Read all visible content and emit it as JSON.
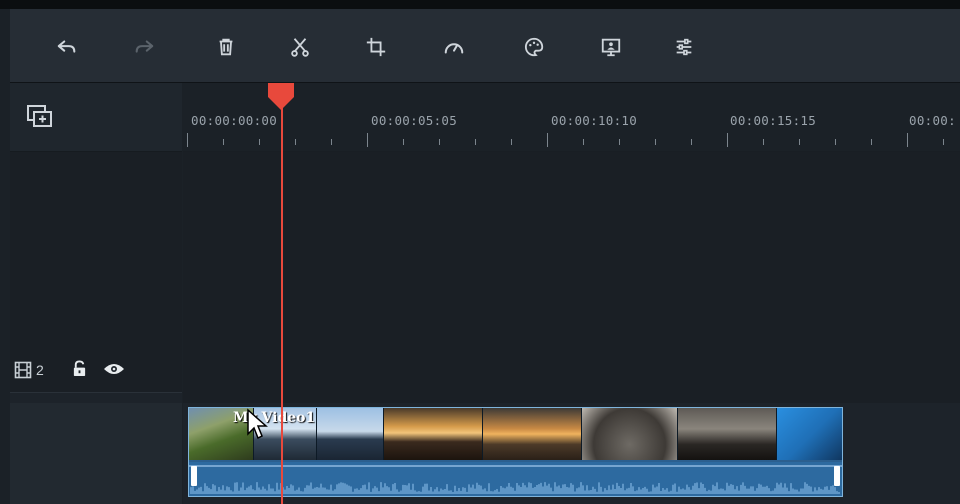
{
  "toolbar": {
    "tools": [
      {
        "name": "undo-icon",
        "label": "Undo",
        "enabled": true
      },
      {
        "name": "redo-icon",
        "label": "Redo",
        "enabled": false
      },
      {
        "name": "delete-icon",
        "label": "Delete",
        "enabled": true
      },
      {
        "name": "cut-icon",
        "label": "Split",
        "enabled": true
      },
      {
        "name": "crop-icon",
        "label": "Crop",
        "enabled": true
      },
      {
        "name": "speed-icon",
        "label": "Speed",
        "enabled": true
      },
      {
        "name": "color-icon",
        "label": "Color",
        "enabled": true
      },
      {
        "name": "green-screen-icon",
        "label": "Green Screen",
        "enabled": true
      },
      {
        "name": "adjust-icon",
        "label": "Adjust",
        "enabled": true
      }
    ]
  },
  "ruler": {
    "ticks": [
      "00:00:00:00",
      "00:00:05:05",
      "00:00:10:10",
      "00:00:15:15",
      "00:00:"
    ]
  },
  "track": {
    "number": "2",
    "icons": [
      "film-icon",
      "lock-icon",
      "eye-icon"
    ]
  },
  "clip": {
    "label": "My Video1"
  },
  "colors": {
    "playhead": "#e8493c",
    "clip_border": "#7fb4dc",
    "audio_wave": "#8fc2ee"
  }
}
